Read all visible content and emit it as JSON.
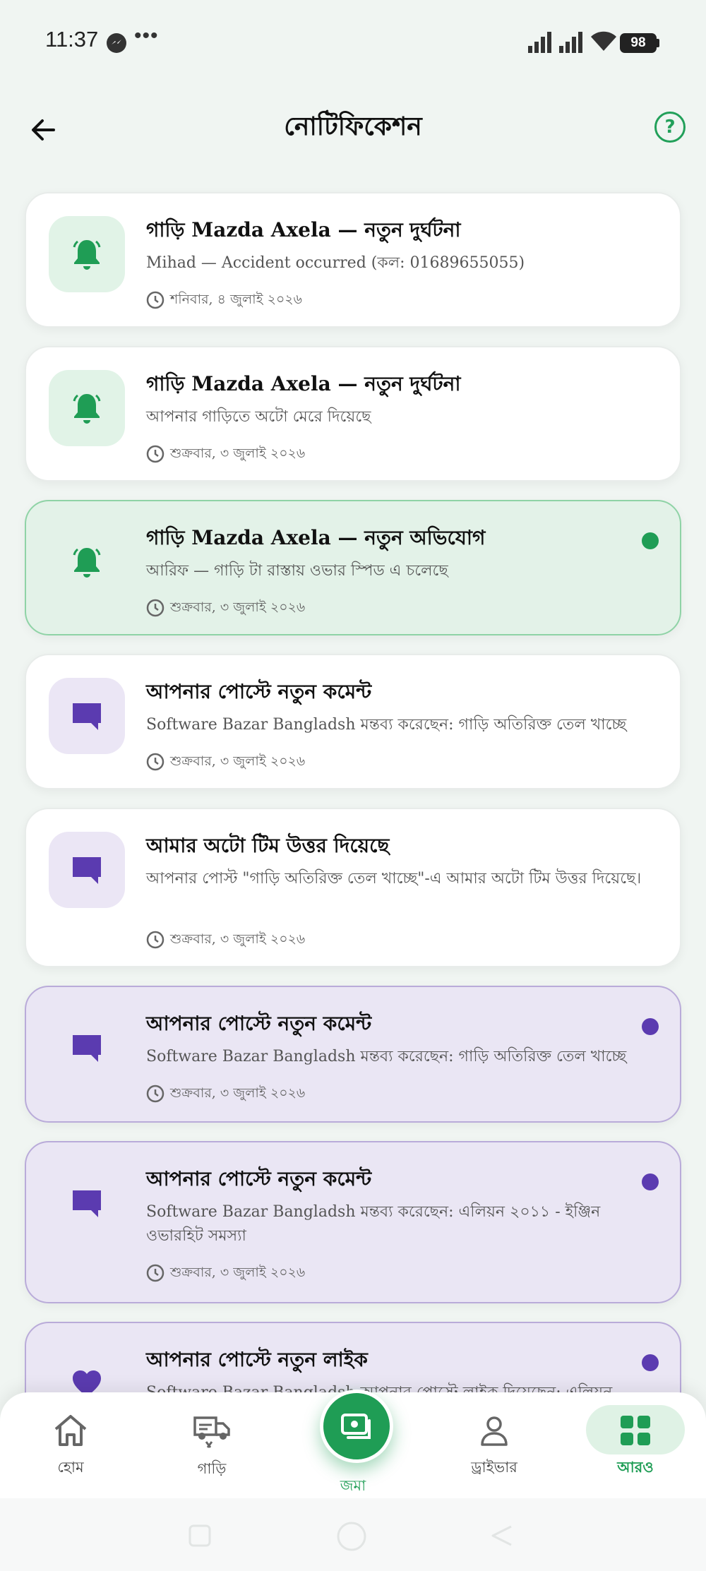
{
  "status_bar": {
    "time": "11:37",
    "dots": "•••",
    "battery": "98"
  },
  "header": {
    "title": "নোটিফিকেশন",
    "help": "?"
  },
  "notifications": [
    {
      "title": "গাড়ি Mazda Axela — নতুন দুর্ঘটনা",
      "body": "Mihad — Accident occurred (কল: 01689655055)",
      "date": "শনিবার, ৪ জুলাই ২০২৬"
    },
    {
      "title": "গাড়ি Mazda Axela — নতুন দুর্ঘটনা",
      "body": "আপনার গাড়িতে অটো মেরে দিয়েছে",
      "date": "শুক্রবার, ৩ জুলাই ২০২৬"
    },
    {
      "title": "গাড়ি Mazda Axela — নতুন অভিযোগ",
      "body": "আরিফ — গাড়ি টা রাস্তায় ওভার স্পিড এ চলেছে",
      "date": "শুক্রবার, ৩ জুলাই ২০২৬"
    },
    {
      "title": "আপনার পোস্টে নতুন কমেন্ট",
      "body": "Software Bazar Bangladsh মন্তব্য করেছেন: গাড়ি অতিরিক্ত তেল খাচ্ছে",
      "date": "শুক্রবার, ৩ জুলাই ২০২৬"
    },
    {
      "title": "আমার অটো টিম উত্তর দিয়েছে",
      "body": "আপনার পোস্ট \"গাড়ি অতিরিক্ত তেল খাচ্ছে\"-এ আমার অটো টিম উত্তর দিয়েছে।",
      "date": "শুক্রবার, ৩ জুলাই ২০২৬"
    },
    {
      "title": "আপনার পোস্টে নতুন কমেন্ট",
      "body": "Software Bazar Bangladsh মন্তব্য করেছেন: গাড়ি অতিরিক্ত তেল খাচ্ছে",
      "date": "শুক্রবার, ৩ জুলাই ২০২৬"
    },
    {
      "title": "আপনার পোস্টে নতুন কমেন্ট",
      "body": "Software Bazar Bangladsh মন্তব্য করেছেন: এলিয়ন ২০১১ - ইঞ্জিন ওভারহিট সমস্যা",
      "date": "শুক্রবার, ৩ জুলাই ২০২৬"
    },
    {
      "title": "আপনার পোস্টে নতুন লাইক",
      "body": "Software Bazar Bangladsh আপনার পোস্টে লাইক দিয়েছেন: এলিয়ন",
      "date": ""
    }
  ],
  "bottom_nav": {
    "home": "হোম",
    "vehicles": "গাড়ি",
    "deposit": "জমা",
    "driver": "ড্রাইভার",
    "more": "আরও"
  },
  "colors": {
    "accent_green": "#1f9d55",
    "accent_purple": "#5b3bb0"
  }
}
